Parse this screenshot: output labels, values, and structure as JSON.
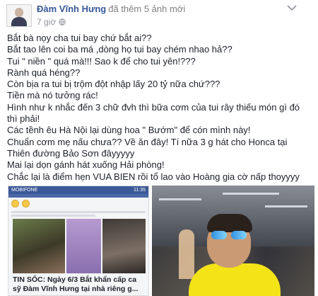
{
  "post": {
    "author": "Đàm Vĩnh Hưng",
    "action": "đã thêm 5 ảnh mới",
    "timestamp": "7 giờ"
  },
  "lines": [
    "Bắt bà nọy cha tui bay chứ bắt ai??",
    "Bắt tao lên coi ba má ,dòng họ tui bay chém nhao hả??",
    "Tui \" niền \" quá mà!!! Sao k để cho tui yên!???",
    "Rành quá héng??",
    "Còn bịa ra tui bị trộm đột nhập lấy 20 tỷ nữa chứ???",
    "Tiền mà nó tưởng rác!",
    "Hình như k nhắc đến 3 chữ đvh thì bữa cơm của tui rây thiếu món gì đó",
    "thì phải!",
    "Các tềnh êu Hà Nội lại dùng hoa \" Bướm\" để cón mình này!",
    "Chuẩn cơm mẹ nấu chưa?? Về ăn đây! Tí nữa 3 g hát cho Honca tại",
    "Thiên đường Bảo Sơn đâyyyyy",
    "Mai lại dọn gánh hát xuống Hải phòng!",
    "Chắc lại là điểm hẹn VUA BIEN rồi tổ lao vào Hoàng gia cờ nấp thoyyyy"
  ],
  "photo1": {
    "carrier": "MOBIFONE",
    "clock": "11:35",
    "news_title_line1": "TIN SỐC: Ngày 6/3 Bắt khẩn cấp ca",
    "news_title_line2": "sỹ Đàm Vĩnh Hưng tại nhà riêng g..."
  }
}
